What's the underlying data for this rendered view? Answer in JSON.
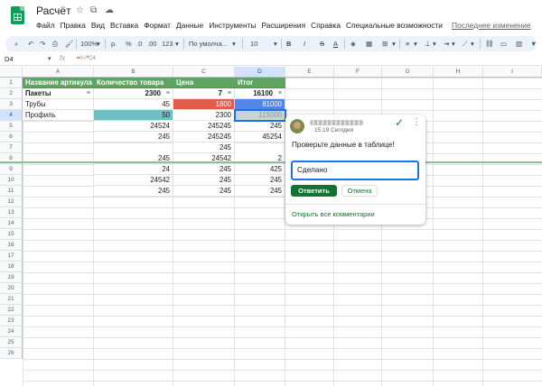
{
  "app": {
    "title": "Расчёт",
    "menus": [
      "Файл",
      "Правка",
      "Вид",
      "Вставка",
      "Формат",
      "Данные",
      "Инструменты",
      "Расширения",
      "Справка",
      "Специальные возможности"
    ],
    "last_edit": "Последнее изменение",
    "icons": {
      "star": "★",
      "move": "▣",
      "cloud": "☁"
    }
  },
  "toolbar": {
    "zoom": "100%",
    "currency": "р.",
    "percent": "%",
    "dec_decrease": ".0",
    "dec_increase": ".00",
    "format_more": "123",
    "font": "По умолча...",
    "font_size": "10",
    "bold": "B",
    "italic": "I",
    "strike": "S",
    "text_color": "A"
  },
  "formula_bar": {
    "cell_ref": "D4",
    "fx": "fx",
    "formula_prefix": "=",
    "formula_ref1": "B4",
    "formula_op": "*",
    "formula_ref2": "C4"
  },
  "grid": {
    "columns": [
      "A",
      "B",
      "C",
      "D",
      "E",
      "F",
      "G",
      "H",
      "I"
    ],
    "selected_column": "D",
    "rows": [
      "1",
      "2",
      "3",
      "4",
      "5",
      "6",
      "7",
      "8",
      "9",
      "10",
      "11",
      "12",
      "13",
      "14",
      "15",
      "16",
      "17",
      "18",
      "19",
      "20",
      "21",
      "22",
      "23",
      "24",
      "25",
      "26"
    ],
    "selected_row": "4",
    "header_row": [
      "Название артикула",
      "Количество товара",
      "Цена",
      "Итог"
    ],
    "summary_row": [
      "Пакеты",
      "2300",
      "7",
      "16100"
    ],
    "data_rows": [
      [
        "Трубы",
        "45",
        "1800",
        "81000"
      ],
      [
        "Профиль",
        "50",
        "2300",
        "115000"
      ],
      [
        "",
        "24524",
        "245245",
        "245"
      ],
      [
        "",
        "245",
        "245245",
        "45254"
      ],
      [
        "",
        "",
        "245",
        ""
      ],
      [
        "",
        "245",
        "24542",
        "2"
      ],
      [
        "",
        "24",
        "245",
        "425"
      ],
      [
        "",
        "24542",
        "245",
        "245"
      ],
      [
        "",
        "245",
        "245",
        "245"
      ]
    ],
    "colors": {
      "header_green": "#5fa463",
      "teal": "#6fbfc4",
      "red": "#e15b48",
      "blue": "#4f86e8",
      "gray": "#cdd3d5"
    }
  },
  "comment": {
    "time": "15:19 Сегодня",
    "text": "Проверьте данные в таблице!",
    "reply_value": "Сделано",
    "reply_button": "Ответить",
    "cancel_button": "Отмена",
    "open_all": "Открыть все комментарии"
  }
}
